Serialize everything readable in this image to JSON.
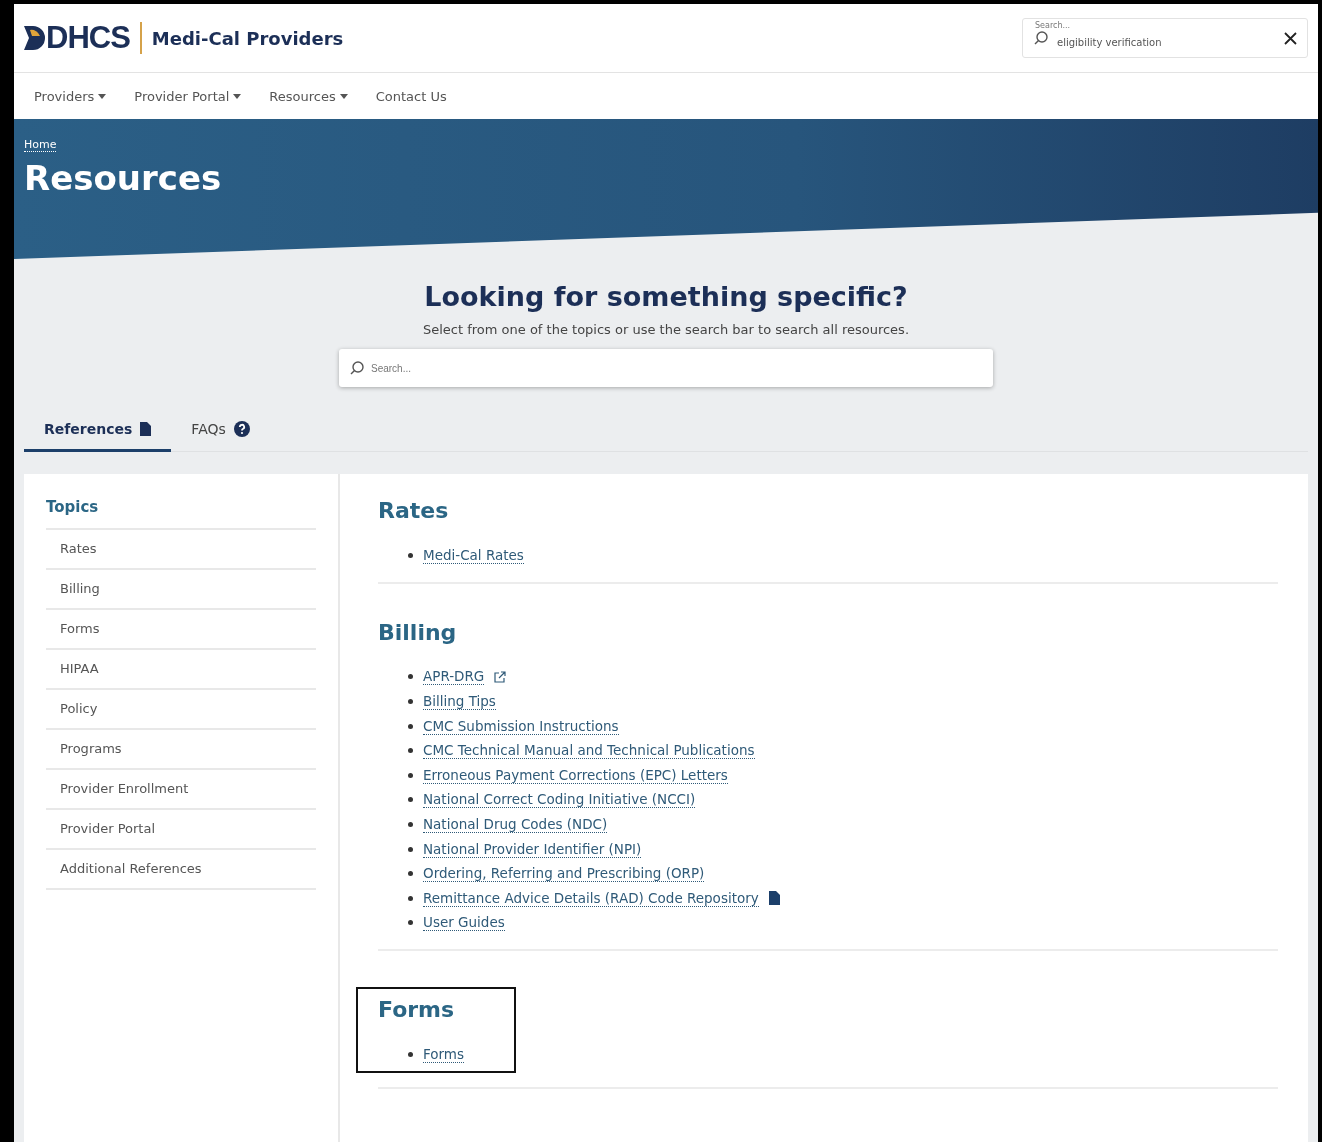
{
  "header": {
    "logo": "DHCS",
    "site_title": "Medi-Cal Providers",
    "search": {
      "placeholder": "Search...",
      "value": "eligibility verification"
    }
  },
  "nav": [
    {
      "label": "Providers",
      "dropdown": true
    },
    {
      "label": "Provider Portal",
      "dropdown": true
    },
    {
      "label": "Resources",
      "dropdown": true
    },
    {
      "label": "Contact Us",
      "dropdown": false
    }
  ],
  "hero": {
    "breadcrumb": "Home",
    "title": "Resources"
  },
  "finder": {
    "heading": "Looking for something specific?",
    "subtitle": "Select from one of the topics or use the search bar to search all resources.",
    "search_placeholder": "Search..."
  },
  "tabs": [
    {
      "label": "References",
      "selected": true
    },
    {
      "label": "FAQs",
      "selected": false
    }
  ],
  "sidebar": {
    "title": "Topics",
    "items": [
      "Rates",
      "Billing",
      "Forms",
      "HIPAA",
      "Policy",
      "Programs",
      "Provider Enrollment",
      "Provider Portal",
      "Additional References"
    ]
  },
  "sections": [
    {
      "title": "Rates",
      "highlighted": false,
      "links": [
        {
          "label": "Medi-Cal Rates"
        }
      ]
    },
    {
      "title": "Billing",
      "highlighted": false,
      "links": [
        {
          "label": "APR-DRG",
          "kind": "external"
        },
        {
          "label": "Billing Tips"
        },
        {
          "label": "CMC Submission Instructions"
        },
        {
          "label": "CMC Technical Manual and Technical Publications"
        },
        {
          "label": "Erroneous Payment Corrections (EPC) Letters"
        },
        {
          "label": "National Correct Coding Initiative (NCCI)"
        },
        {
          "label": "National Drug Codes (NDC)"
        },
        {
          "label": "National Provider Identifier (NPI)"
        },
        {
          "label": "Ordering, Referring and Prescribing (ORP)"
        },
        {
          "label": "Remittance Advice Details (RAD) Code Repository",
          "kind": "file"
        },
        {
          "label": "User Guides"
        }
      ]
    },
    {
      "title": "Forms",
      "highlighted": true,
      "links": [
        {
          "label": "Forms"
        }
      ]
    }
  ]
}
